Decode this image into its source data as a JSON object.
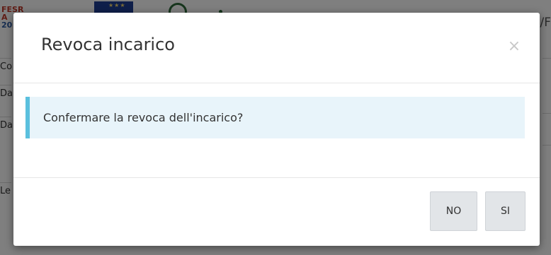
{
  "background": {
    "logo_lines": [
      "FESR",
      "A",
      "20"
    ],
    "right_text": "i/F",
    "row_labels": [
      "Co",
      "Da",
      "Da",
      "Le"
    ]
  },
  "modal": {
    "title": "Revoca incarico",
    "close_icon": "×",
    "message": "Confermare la revoca dell'incarico?",
    "buttons": {
      "no_label": "NO",
      "si_label": "SI"
    }
  },
  "colors": {
    "alert_background": "#e8f4fa",
    "alert_border": "#5bc0de",
    "button_background": "#e2e5e8"
  }
}
